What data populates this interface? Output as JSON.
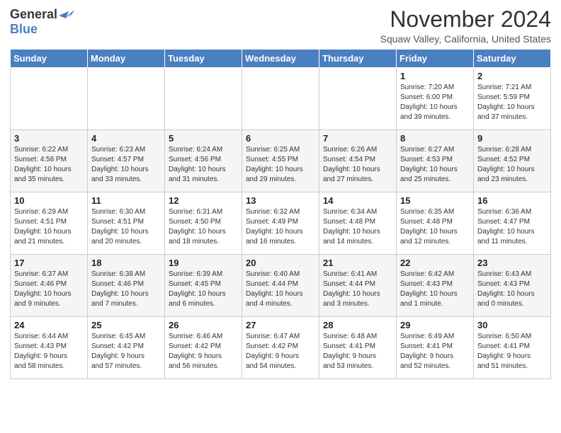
{
  "logo": {
    "general": "General",
    "blue": "Blue"
  },
  "header": {
    "month_title": "November 2024",
    "location": "Squaw Valley, California, United States"
  },
  "weekdays": [
    "Sunday",
    "Monday",
    "Tuesday",
    "Wednesday",
    "Thursday",
    "Friday",
    "Saturday"
  ],
  "weeks": [
    [
      {
        "day": "",
        "info": ""
      },
      {
        "day": "",
        "info": ""
      },
      {
        "day": "",
        "info": ""
      },
      {
        "day": "",
        "info": ""
      },
      {
        "day": "",
        "info": ""
      },
      {
        "day": "1",
        "info": "Sunrise: 7:20 AM\nSunset: 6:00 PM\nDaylight: 10 hours\nand 39 minutes."
      },
      {
        "day": "2",
        "info": "Sunrise: 7:21 AM\nSunset: 5:59 PM\nDaylight: 10 hours\nand 37 minutes."
      }
    ],
    [
      {
        "day": "3",
        "info": "Sunrise: 6:22 AM\nSunset: 4:58 PM\nDaylight: 10 hours\nand 35 minutes."
      },
      {
        "day": "4",
        "info": "Sunrise: 6:23 AM\nSunset: 4:57 PM\nDaylight: 10 hours\nand 33 minutes."
      },
      {
        "day": "5",
        "info": "Sunrise: 6:24 AM\nSunset: 4:56 PM\nDaylight: 10 hours\nand 31 minutes."
      },
      {
        "day": "6",
        "info": "Sunrise: 6:25 AM\nSunset: 4:55 PM\nDaylight: 10 hours\nand 29 minutes."
      },
      {
        "day": "7",
        "info": "Sunrise: 6:26 AM\nSunset: 4:54 PM\nDaylight: 10 hours\nand 27 minutes."
      },
      {
        "day": "8",
        "info": "Sunrise: 6:27 AM\nSunset: 4:53 PM\nDaylight: 10 hours\nand 25 minutes."
      },
      {
        "day": "9",
        "info": "Sunrise: 6:28 AM\nSunset: 4:52 PM\nDaylight: 10 hours\nand 23 minutes."
      }
    ],
    [
      {
        "day": "10",
        "info": "Sunrise: 6:29 AM\nSunset: 4:51 PM\nDaylight: 10 hours\nand 21 minutes."
      },
      {
        "day": "11",
        "info": "Sunrise: 6:30 AM\nSunset: 4:51 PM\nDaylight: 10 hours\nand 20 minutes."
      },
      {
        "day": "12",
        "info": "Sunrise: 6:31 AM\nSunset: 4:50 PM\nDaylight: 10 hours\nand 18 minutes."
      },
      {
        "day": "13",
        "info": "Sunrise: 6:32 AM\nSunset: 4:49 PM\nDaylight: 10 hours\nand 16 minutes."
      },
      {
        "day": "14",
        "info": "Sunrise: 6:34 AM\nSunset: 4:48 PM\nDaylight: 10 hours\nand 14 minutes."
      },
      {
        "day": "15",
        "info": "Sunrise: 6:35 AM\nSunset: 4:48 PM\nDaylight: 10 hours\nand 12 minutes."
      },
      {
        "day": "16",
        "info": "Sunrise: 6:36 AM\nSunset: 4:47 PM\nDaylight: 10 hours\nand 11 minutes."
      }
    ],
    [
      {
        "day": "17",
        "info": "Sunrise: 6:37 AM\nSunset: 4:46 PM\nDaylight: 10 hours\nand 9 minutes."
      },
      {
        "day": "18",
        "info": "Sunrise: 6:38 AM\nSunset: 4:46 PM\nDaylight: 10 hours\nand 7 minutes."
      },
      {
        "day": "19",
        "info": "Sunrise: 6:39 AM\nSunset: 4:45 PM\nDaylight: 10 hours\nand 6 minutes."
      },
      {
        "day": "20",
        "info": "Sunrise: 6:40 AM\nSunset: 4:44 PM\nDaylight: 10 hours\nand 4 minutes."
      },
      {
        "day": "21",
        "info": "Sunrise: 6:41 AM\nSunset: 4:44 PM\nDaylight: 10 hours\nand 3 minutes."
      },
      {
        "day": "22",
        "info": "Sunrise: 6:42 AM\nSunset: 4:43 PM\nDaylight: 10 hours\nand 1 minute."
      },
      {
        "day": "23",
        "info": "Sunrise: 6:43 AM\nSunset: 4:43 PM\nDaylight: 10 hours\nand 0 minutes."
      }
    ],
    [
      {
        "day": "24",
        "info": "Sunrise: 6:44 AM\nSunset: 4:43 PM\nDaylight: 9 hours\nand 58 minutes."
      },
      {
        "day": "25",
        "info": "Sunrise: 6:45 AM\nSunset: 4:42 PM\nDaylight: 9 hours\nand 57 minutes."
      },
      {
        "day": "26",
        "info": "Sunrise: 6:46 AM\nSunset: 4:42 PM\nDaylight: 9 hours\nand 56 minutes."
      },
      {
        "day": "27",
        "info": "Sunrise: 6:47 AM\nSunset: 4:42 PM\nDaylight: 9 hours\nand 54 minutes."
      },
      {
        "day": "28",
        "info": "Sunrise: 6:48 AM\nSunset: 4:41 PM\nDaylight: 9 hours\nand 53 minutes."
      },
      {
        "day": "29",
        "info": "Sunrise: 6:49 AM\nSunset: 4:41 PM\nDaylight: 9 hours\nand 52 minutes."
      },
      {
        "day": "30",
        "info": "Sunrise: 6:50 AM\nSunset: 4:41 PM\nDaylight: 9 hours\nand 51 minutes."
      }
    ]
  ]
}
